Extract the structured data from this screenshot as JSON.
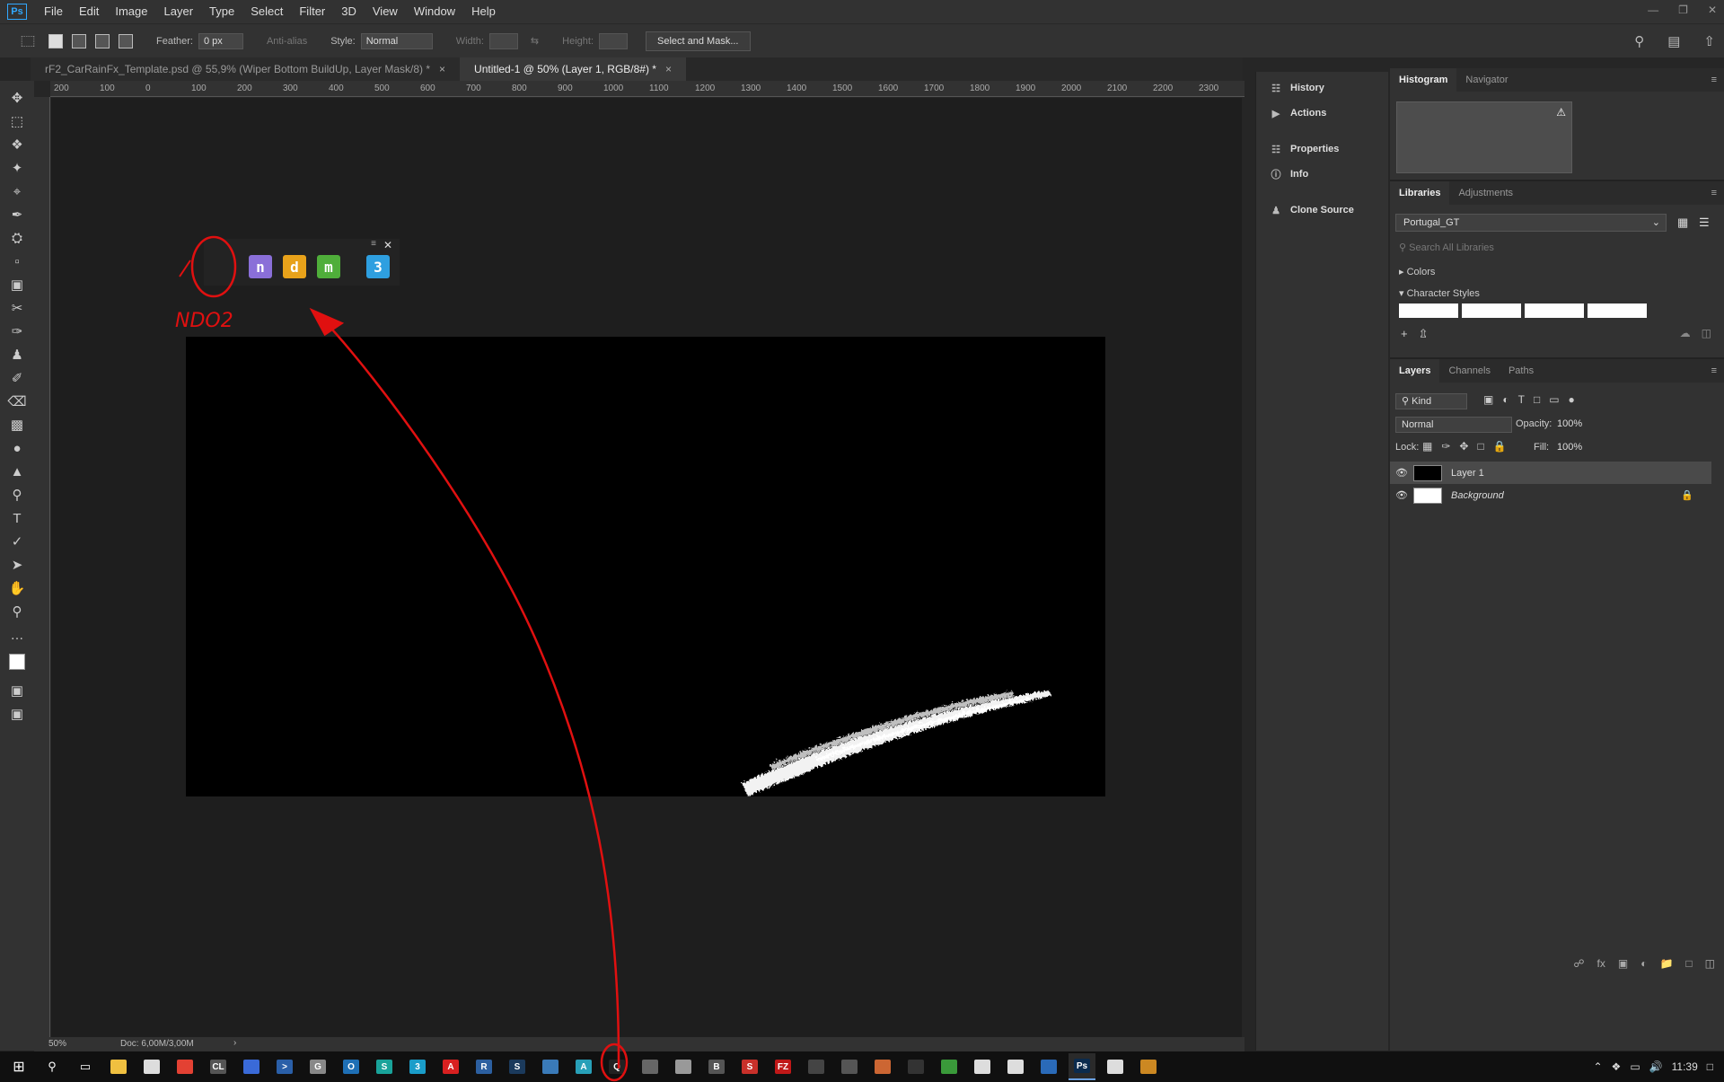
{
  "app": {
    "logo": "Ps"
  },
  "menu": [
    "File",
    "Edit",
    "Image",
    "Layer",
    "Type",
    "Select",
    "Filter",
    "3D",
    "View",
    "Window",
    "Help"
  ],
  "options": {
    "feather_label": "Feather:",
    "feather_value": "0 px",
    "antialias_label": "Anti-alias",
    "style_label": "Style:",
    "style_value": "Normal",
    "width_label": "Width:",
    "height_label": "Height:",
    "select_mask": "Select and Mask..."
  },
  "tabs": [
    {
      "label": "rF2_CarRainFx_Template.psd @ 55,9% (Wiper Bottom BuildUp, Layer Mask/8) *"
    },
    {
      "label": "Untitled-1 @ 50% (Layer 1, RGB/8#) *"
    }
  ],
  "ruler_labels": [
    "200",
    "100",
    "0",
    "100",
    "200",
    "300",
    "400",
    "500",
    "600",
    "700",
    "800",
    "900",
    "1000",
    "1100",
    "1200",
    "1300",
    "1400",
    "1500",
    "1600",
    "1700",
    "1800",
    "1900",
    "2000",
    "2100",
    "2200",
    "2300"
  ],
  "plugin_panel": {
    "icons": [
      {
        "name": "ndo2",
        "glyph": "n",
        "color": "#8a6fd8"
      },
      {
        "name": "ddo",
        "glyph": "d",
        "color": "#e8a21a"
      },
      {
        "name": "mdo",
        "glyph": "m",
        "color": "#4fae3a"
      },
      {
        "name": "3do",
        "glyph": "3",
        "color": "#2e9fe0"
      }
    ],
    "annotation": "NDO2"
  },
  "status": {
    "zoom": "50%",
    "doc": "Doc: 6,00M/3,00M"
  },
  "dock": [
    "History",
    "Actions",
    "Properties",
    "Info",
    "Clone Source"
  ],
  "histogram_tabs": [
    "Histogram",
    "Navigator"
  ],
  "libraries_tabs": [
    "Libraries",
    "Adjustments"
  ],
  "libraries": {
    "selected": "Portugal_GT",
    "search_placeholder": "Search All Libraries",
    "sections": [
      "Colors",
      "Character Styles"
    ]
  },
  "layers_tabs": [
    "Layers",
    "Channels",
    "Paths"
  ],
  "layers_panel": {
    "kind": "Kind",
    "blend": "Normal",
    "opacity_label": "Opacity:",
    "opacity": "100%",
    "lock_label": "Lock:",
    "fill_label": "Fill:",
    "fill": "100%",
    "layers": [
      {
        "name": "Layer 1",
        "thumb": "#000000",
        "selected": true
      },
      {
        "name": "Background",
        "thumb": "#ffffff",
        "selected": false
      }
    ]
  },
  "taskbar": {
    "apps": [
      {
        "name": "file-explorer",
        "color": "#f0c040",
        "glyph": ""
      },
      {
        "name": "store",
        "color": "#ddd",
        "glyph": ""
      },
      {
        "name": "chrome",
        "color": "#e34133",
        "glyph": ""
      },
      {
        "name": "calc",
        "color": "#555",
        "glyph": "CL"
      },
      {
        "name": "app-a",
        "color": "#3a6ad8",
        "glyph": ""
      },
      {
        "name": "powershell",
        "color": "#2a5fa8",
        "glyph": ">"
      },
      {
        "name": "app-b",
        "color": "#888",
        "glyph": "G"
      },
      {
        "name": "app-c",
        "color": "#1e6fb5",
        "glyph": "O"
      },
      {
        "name": "app-d",
        "color": "#19a39a",
        "glyph": "S"
      },
      {
        "name": "app-e",
        "color": "#1a9dc9",
        "glyph": "3"
      },
      {
        "name": "acrobat",
        "color": "#d82020",
        "glyph": "A"
      },
      {
        "name": "app-r",
        "color": "#2c5fa0",
        "glyph": "R"
      },
      {
        "name": "steam",
        "color": "#1b3a5c",
        "glyph": "S"
      },
      {
        "name": "app-f",
        "color": "#3a7ab8",
        "glyph": ""
      },
      {
        "name": "app-g",
        "color": "#28a0b8",
        "glyph": "A"
      },
      {
        "name": "app-q",
        "color": "#222",
        "glyph": "Q"
      },
      {
        "name": "app-h",
        "color": "#666",
        "glyph": ""
      },
      {
        "name": "app-i",
        "color": "#999",
        "glyph": ""
      },
      {
        "name": "app-j",
        "color": "#555",
        "glyph": "B"
      },
      {
        "name": "app-k",
        "color": "#c8302a",
        "glyph": "S"
      },
      {
        "name": "filezilla",
        "color": "#c01818",
        "glyph": "FZ"
      },
      {
        "name": "app-l",
        "color": "#444",
        "glyph": ""
      },
      {
        "name": "app-m",
        "color": "#555",
        "glyph": ""
      },
      {
        "name": "app-n",
        "color": "#c63",
        "glyph": ""
      },
      {
        "name": "app-o",
        "color": "#333",
        "glyph": ""
      },
      {
        "name": "app-p",
        "color": "#3a9a3a",
        "glyph": ""
      },
      {
        "name": "app-s",
        "color": "#ddd",
        "glyph": ""
      },
      {
        "name": "mail",
        "color": "#ddd",
        "glyph": ""
      },
      {
        "name": "app-t",
        "color": "#2a6ab8",
        "glyph": ""
      },
      {
        "name": "photoshop",
        "color": "#0b2b4d",
        "glyph": "Ps"
      },
      {
        "name": "photos",
        "color": "#ddd",
        "glyph": ""
      },
      {
        "name": "app-u",
        "color": "#c82",
        "glyph": ""
      }
    ],
    "time": "11:39"
  }
}
